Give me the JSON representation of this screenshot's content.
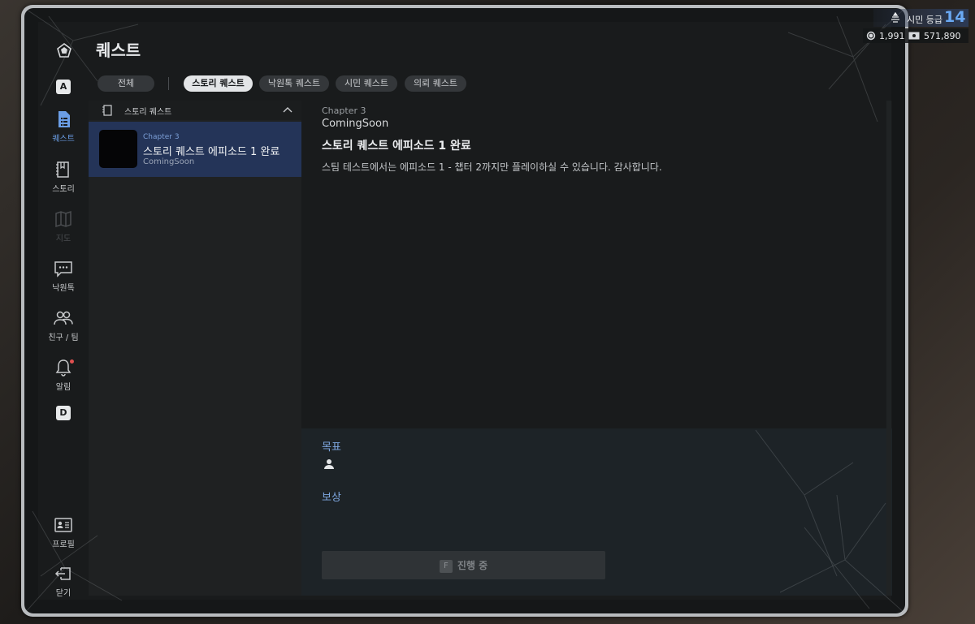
{
  "page": {
    "title": "퀘스트"
  },
  "sidebar": {
    "key_top": "A",
    "key_bottom": "D",
    "items": [
      {
        "label": "퀘스트",
        "icon": "quest-document-icon",
        "active": true
      },
      {
        "label": "스토리",
        "icon": "story-book-icon"
      },
      {
        "label": "지도",
        "icon": "map-icon",
        "disabled": true
      },
      {
        "label": "낙원톡",
        "icon": "chat-bubble-icon"
      },
      {
        "label": "친구 / 팀",
        "icon": "friends-icon"
      },
      {
        "label": "알림",
        "icon": "bell-icon"
      },
      {
        "label": "프로필",
        "icon": "profile-card-icon"
      },
      {
        "label": "닫기",
        "icon": "exit-icon"
      }
    ]
  },
  "tabs": [
    {
      "label": "전체"
    },
    {
      "label": "스토리 퀘스트",
      "active": true
    },
    {
      "label": "낙원톡 퀘스트"
    },
    {
      "label": "시민 퀘스트"
    },
    {
      "label": "의뢰 퀘스트"
    }
  ],
  "quest_list": {
    "header": "스토리 퀘스트",
    "items": [
      {
        "chapter": "Chapter 3",
        "name": "스토리 퀘스트 에피소드 1 완료",
        "status": "ComingSoon"
      }
    ]
  },
  "detail": {
    "chapter": "Chapter 3",
    "subtitle": "ComingSoon",
    "title": "스토리 퀘스트 에피소드 1 완료",
    "description": "스팀 테스트에서는 에피소드 1 - 챕터 2까지만 플레이하실 수 있습니다. 감사합니다.",
    "goal_label": "목표",
    "reward_label": "보상",
    "button": {
      "key": "F",
      "label": "진행 중"
    }
  },
  "hud": {
    "rank_label": "시민 등급",
    "rank_value": "14",
    "coin": "1,991",
    "cash": "571,890"
  },
  "colors": {
    "accent": "#6b9ee6",
    "selected_row": "#243458",
    "rank_value": "#6aa9f4"
  }
}
